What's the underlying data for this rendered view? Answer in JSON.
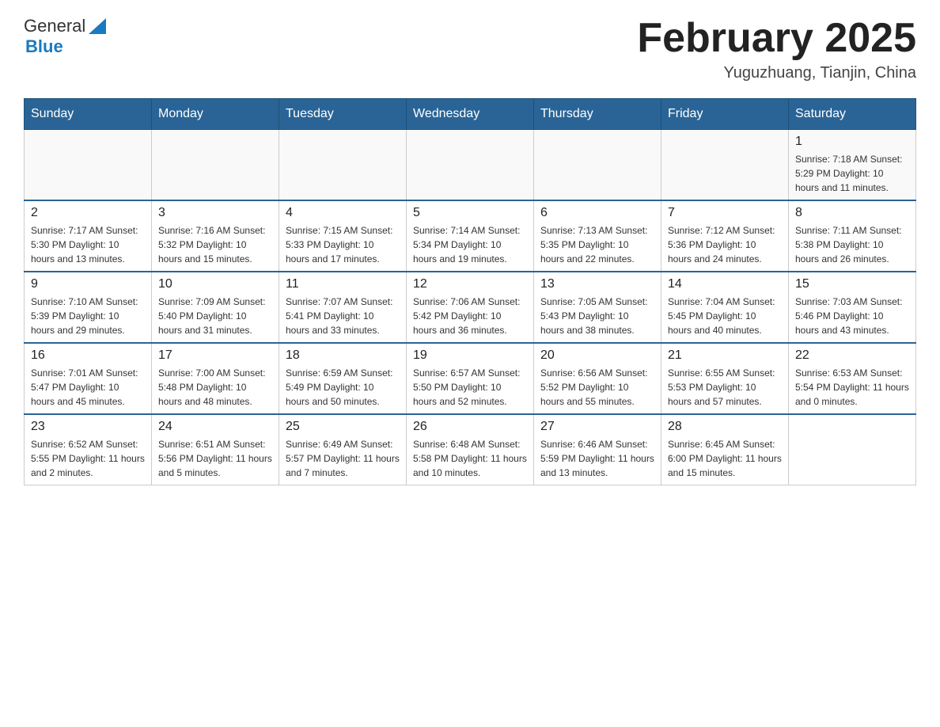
{
  "header": {
    "title": "February 2025",
    "location": "Yuguzhuang, Tianjin, China",
    "logo_general": "General",
    "logo_blue": "Blue"
  },
  "days_of_week": [
    "Sunday",
    "Monday",
    "Tuesday",
    "Wednesday",
    "Thursday",
    "Friday",
    "Saturday"
  ],
  "weeks": [
    [
      {
        "day": "",
        "info": ""
      },
      {
        "day": "",
        "info": ""
      },
      {
        "day": "",
        "info": ""
      },
      {
        "day": "",
        "info": ""
      },
      {
        "day": "",
        "info": ""
      },
      {
        "day": "",
        "info": ""
      },
      {
        "day": "1",
        "info": "Sunrise: 7:18 AM\nSunset: 5:29 PM\nDaylight: 10 hours and 11 minutes."
      }
    ],
    [
      {
        "day": "2",
        "info": "Sunrise: 7:17 AM\nSunset: 5:30 PM\nDaylight: 10 hours and 13 minutes."
      },
      {
        "day": "3",
        "info": "Sunrise: 7:16 AM\nSunset: 5:32 PM\nDaylight: 10 hours and 15 minutes."
      },
      {
        "day": "4",
        "info": "Sunrise: 7:15 AM\nSunset: 5:33 PM\nDaylight: 10 hours and 17 minutes."
      },
      {
        "day": "5",
        "info": "Sunrise: 7:14 AM\nSunset: 5:34 PM\nDaylight: 10 hours and 19 minutes."
      },
      {
        "day": "6",
        "info": "Sunrise: 7:13 AM\nSunset: 5:35 PM\nDaylight: 10 hours and 22 minutes."
      },
      {
        "day": "7",
        "info": "Sunrise: 7:12 AM\nSunset: 5:36 PM\nDaylight: 10 hours and 24 minutes."
      },
      {
        "day": "8",
        "info": "Sunrise: 7:11 AM\nSunset: 5:38 PM\nDaylight: 10 hours and 26 minutes."
      }
    ],
    [
      {
        "day": "9",
        "info": "Sunrise: 7:10 AM\nSunset: 5:39 PM\nDaylight: 10 hours and 29 minutes."
      },
      {
        "day": "10",
        "info": "Sunrise: 7:09 AM\nSunset: 5:40 PM\nDaylight: 10 hours and 31 minutes."
      },
      {
        "day": "11",
        "info": "Sunrise: 7:07 AM\nSunset: 5:41 PM\nDaylight: 10 hours and 33 minutes."
      },
      {
        "day": "12",
        "info": "Sunrise: 7:06 AM\nSunset: 5:42 PM\nDaylight: 10 hours and 36 minutes."
      },
      {
        "day": "13",
        "info": "Sunrise: 7:05 AM\nSunset: 5:43 PM\nDaylight: 10 hours and 38 minutes."
      },
      {
        "day": "14",
        "info": "Sunrise: 7:04 AM\nSunset: 5:45 PM\nDaylight: 10 hours and 40 minutes."
      },
      {
        "day": "15",
        "info": "Sunrise: 7:03 AM\nSunset: 5:46 PM\nDaylight: 10 hours and 43 minutes."
      }
    ],
    [
      {
        "day": "16",
        "info": "Sunrise: 7:01 AM\nSunset: 5:47 PM\nDaylight: 10 hours and 45 minutes."
      },
      {
        "day": "17",
        "info": "Sunrise: 7:00 AM\nSunset: 5:48 PM\nDaylight: 10 hours and 48 minutes."
      },
      {
        "day": "18",
        "info": "Sunrise: 6:59 AM\nSunset: 5:49 PM\nDaylight: 10 hours and 50 minutes."
      },
      {
        "day": "19",
        "info": "Sunrise: 6:57 AM\nSunset: 5:50 PM\nDaylight: 10 hours and 52 minutes."
      },
      {
        "day": "20",
        "info": "Sunrise: 6:56 AM\nSunset: 5:52 PM\nDaylight: 10 hours and 55 minutes."
      },
      {
        "day": "21",
        "info": "Sunrise: 6:55 AM\nSunset: 5:53 PM\nDaylight: 10 hours and 57 minutes."
      },
      {
        "day": "22",
        "info": "Sunrise: 6:53 AM\nSunset: 5:54 PM\nDaylight: 11 hours and 0 minutes."
      }
    ],
    [
      {
        "day": "23",
        "info": "Sunrise: 6:52 AM\nSunset: 5:55 PM\nDaylight: 11 hours and 2 minutes."
      },
      {
        "day": "24",
        "info": "Sunrise: 6:51 AM\nSunset: 5:56 PM\nDaylight: 11 hours and 5 minutes."
      },
      {
        "day": "25",
        "info": "Sunrise: 6:49 AM\nSunset: 5:57 PM\nDaylight: 11 hours and 7 minutes."
      },
      {
        "day": "26",
        "info": "Sunrise: 6:48 AM\nSunset: 5:58 PM\nDaylight: 11 hours and 10 minutes."
      },
      {
        "day": "27",
        "info": "Sunrise: 6:46 AM\nSunset: 5:59 PM\nDaylight: 11 hours and 13 minutes."
      },
      {
        "day": "28",
        "info": "Sunrise: 6:45 AM\nSunset: 6:00 PM\nDaylight: 11 hours and 15 minutes."
      },
      {
        "day": "",
        "info": ""
      }
    ]
  ]
}
